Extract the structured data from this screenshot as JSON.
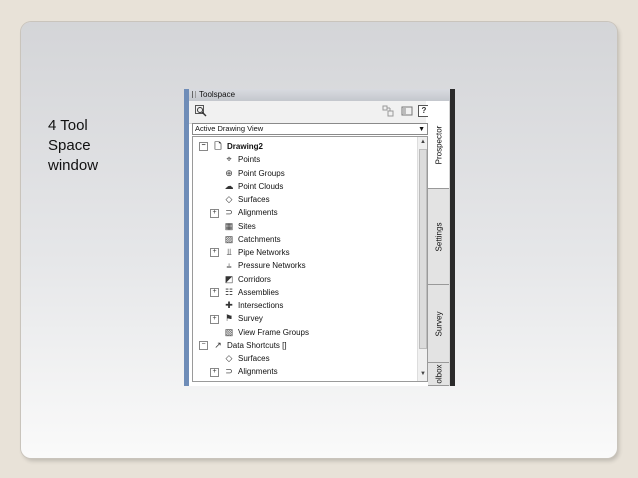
{
  "slide": {
    "caption_lines": [
      "4 Tool",
      "Space",
      "window"
    ]
  },
  "toolspace": {
    "title": "Toolspace",
    "dropdown_value": "Active Drawing View",
    "toolbar": {
      "search_icon": "search-icon",
      "help_label": "?"
    },
    "tree": [
      {
        "label": "Drawing2",
        "level": 0,
        "expander": "minus",
        "icon": "drawing-icon",
        "bold": true
      },
      {
        "label": "Points",
        "level": 1,
        "expander": "none",
        "icon": "points-icon"
      },
      {
        "label": "Point Groups",
        "level": 1,
        "expander": "none",
        "icon": "point-groups-icon"
      },
      {
        "label": "Point Clouds",
        "level": 1,
        "expander": "none",
        "icon": "point-clouds-icon"
      },
      {
        "label": "Surfaces",
        "level": 1,
        "expander": "none",
        "icon": "surfaces-icon"
      },
      {
        "label": "Alignments",
        "level": 1,
        "expander": "plus",
        "icon": "alignments-icon"
      },
      {
        "label": "Sites",
        "level": 1,
        "expander": "none",
        "icon": "sites-icon"
      },
      {
        "label": "Catchments",
        "level": 1,
        "expander": "none",
        "icon": "catchments-icon"
      },
      {
        "label": "Pipe Networks",
        "level": 1,
        "expander": "plus",
        "icon": "pipe-networks-icon"
      },
      {
        "label": "Pressure Networks",
        "level": 1,
        "expander": "none",
        "icon": "pressure-networks-icon"
      },
      {
        "label": "Corridors",
        "level": 1,
        "expander": "none",
        "icon": "corridors-icon"
      },
      {
        "label": "Assemblies",
        "level": 1,
        "expander": "plus",
        "icon": "assemblies-icon"
      },
      {
        "label": "Intersections",
        "level": 1,
        "expander": "none",
        "icon": "intersections-icon"
      },
      {
        "label": "Survey",
        "level": 1,
        "expander": "plus",
        "icon": "survey-icon"
      },
      {
        "label": "View Frame Groups",
        "level": 1,
        "expander": "none",
        "icon": "view-frame-groups-icon"
      },
      {
        "label": "Data Shortcuts []",
        "level": 0,
        "expander": "minus",
        "icon": "data-shortcuts-icon"
      },
      {
        "label": "Surfaces",
        "level": 1,
        "expander": "none",
        "icon": "surfaces-icon"
      },
      {
        "label": "Alignments",
        "level": 1,
        "expander": "plus",
        "icon": "alignments-icon"
      }
    ],
    "tabs": [
      "Prospector",
      "Settings",
      "Survey",
      "olbox"
    ]
  }
}
